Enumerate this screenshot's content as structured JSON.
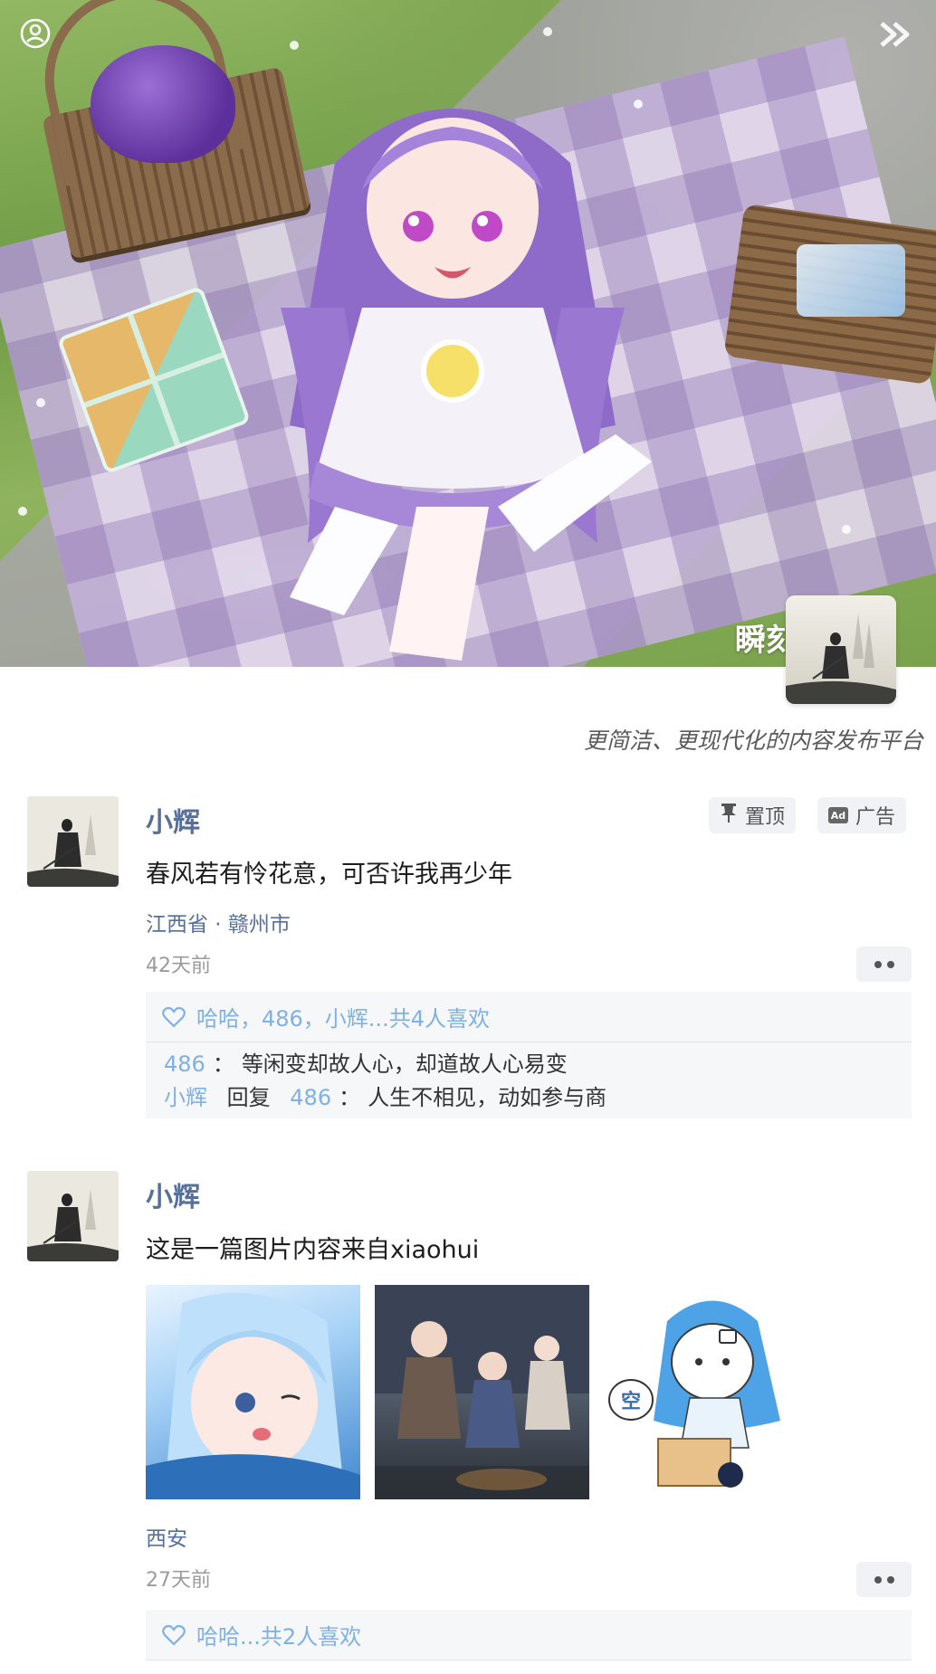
{
  "header": {
    "app_name": "瞬刻",
    "tagline": "更简洁、更现代化的内容发布平台"
  },
  "posts": [
    {
      "author": "小辉",
      "content": "春风若有怜花意，可否许我再少年",
      "location": "江西省 · 赣州市",
      "time": "42天前",
      "tags": {
        "pinned": "置顶",
        "ad": "广告",
        "ad_badge": "Ad"
      },
      "likes": "哈哈，486，小辉...共4人喜欢",
      "comments": [
        {
          "user": "486",
          "colon": "：",
          "text": "等闲变却故人心，却道故人心易变"
        },
        {
          "user": "小辉",
          "reply_word": "回复",
          "reply_to": "486",
          "colon": "：",
          "text": "人生不相见，动如参与商"
        }
      ]
    },
    {
      "author": "小辉",
      "content": "这是一篇图片内容来自xiaohui",
      "location": "西安",
      "time": "27天前",
      "sticker_text": "空",
      "likes": "哈哈...共2人喜欢"
    }
  ],
  "colors": {
    "accent_blue": "#56709a",
    "like_blue": "#7fb0e6",
    "muted_gray": "#9b9b9b",
    "tag_bg": "#f1f2f5"
  },
  "icons": [
    "user-circle-icon",
    "double-chevron-right-icon",
    "pin-icon",
    "ad-icon",
    "heart-icon",
    "more-dots-icon"
  ]
}
